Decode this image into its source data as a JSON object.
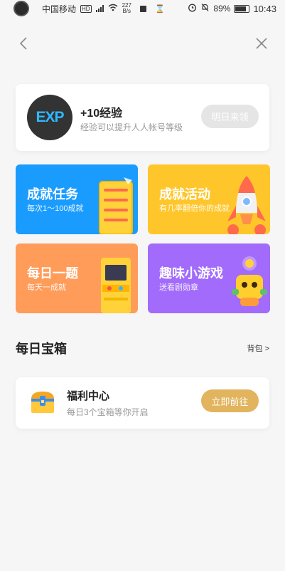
{
  "status_bar": {
    "carrier": "中国移动",
    "hd": "HD",
    "network": "4G",
    "speed_value": "227",
    "speed_unit": "B/s",
    "battery": "89%",
    "time": "10:43"
  },
  "exp_card": {
    "badge": "EXP",
    "title": "+10经验",
    "subtitle": "经验可以提升人人帐号等级",
    "button": "明日来领"
  },
  "tiles": [
    {
      "title": "成就任务",
      "subtitle": "每次1～100成就",
      "color": "#1a9cff"
    },
    {
      "title": "成就活动",
      "subtitle": "有几率翻倍你的成就",
      "color": "#ffc62b"
    },
    {
      "title": "每日一题",
      "subtitle": "每天一成就",
      "color": "#ff9c5a"
    },
    {
      "title": "趣味小游戏",
      "subtitle": "送看剧勋章",
      "color": "#a26bfb"
    }
  ],
  "daily_box": {
    "title": "每日宝箱",
    "link": "背包 >"
  },
  "welfare": {
    "title": "福利中心",
    "subtitle": "每日3个宝箱等你开启",
    "button": "立即前往"
  }
}
